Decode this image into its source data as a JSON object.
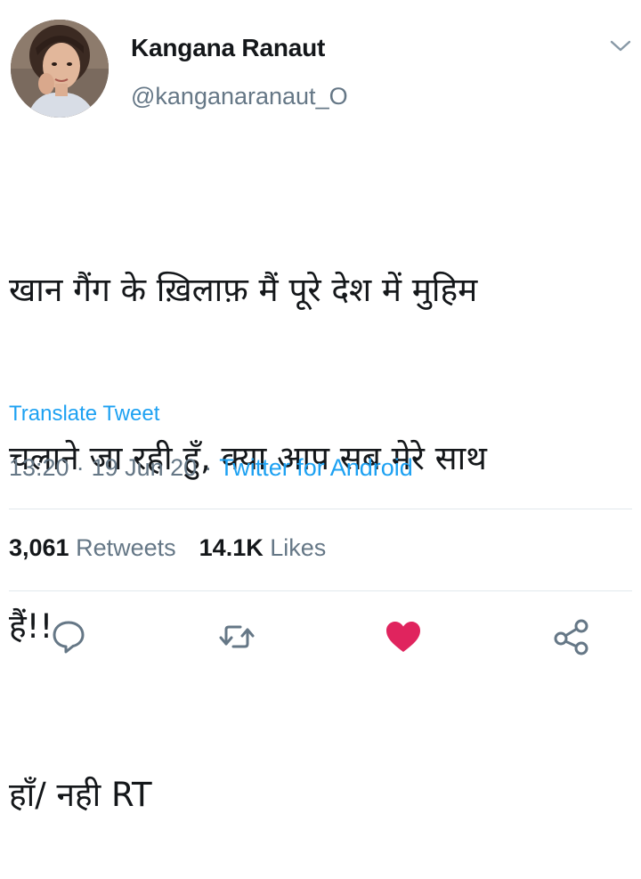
{
  "tweet": {
    "author": {
      "display_name": "Kangana Ranaut",
      "handle": "@kanganaranaut_O"
    },
    "text_lines": [
      "खान गैंग के ख़िलाफ़ मैं पूरे देश में मुहिम",
      "चलाने जा रही हुँ, क्या आप सब मेरे साथ",
      "हैं!!",
      "हाँ/ नही RT"
    ],
    "translate_label": "Translate Tweet",
    "time": "13:20",
    "date": "19 Jun 20",
    "separator": "·",
    "source": "Twitter for Android",
    "stats": {
      "retweets_count": "3,061",
      "retweets_label": "Retweets",
      "likes_count": "14.1K",
      "likes_label": "Likes"
    }
  },
  "icons": {
    "caret": "chevron-down-icon",
    "reply": "reply-icon",
    "retweet": "retweet-icon",
    "like": "heart-icon",
    "share": "share-icon"
  },
  "colors": {
    "link": "#1da1f2",
    "secondary_text": "#657786",
    "primary_text": "#14171a",
    "like_active": "#e0245e",
    "divider": "#e1e8ed"
  }
}
